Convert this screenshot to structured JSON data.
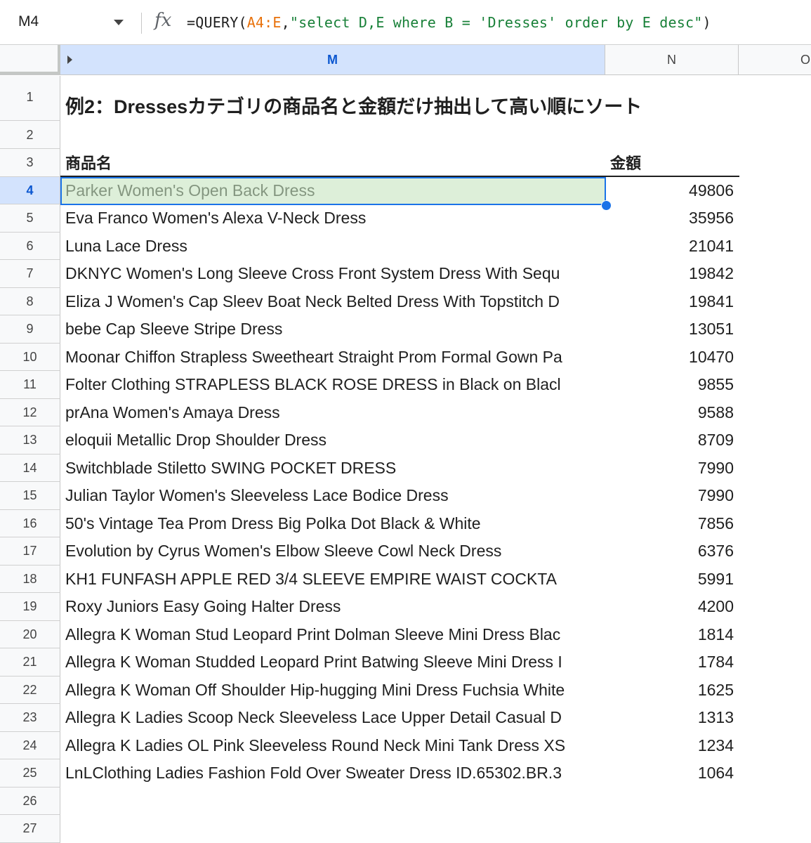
{
  "formula_bar": {
    "cell_ref": "M4",
    "fx_symbol": "fx",
    "formula_prefix": "=QUERY(",
    "formula_range": "A4:E",
    "formula_mid": ",",
    "formula_string": "\"select D,E where B = 'Dresses' order by E desc\"",
    "formula_suffix": ")"
  },
  "columns": {
    "m": "M",
    "n": "N",
    "o": "O"
  },
  "sheet": {
    "title": "例2：Dressesカテゴリの商品名と金額だけ抽出して高い順にソート",
    "header_name": "商品名",
    "header_amount": "金額",
    "rows": [
      {
        "name": "Parker Women's Open Back Dress",
        "amount": "49806"
      },
      {
        "name": "Eva Franco Women's Alexa V-Neck Dress",
        "amount": "35956"
      },
      {
        "name": "Luna Lace Dress",
        "amount": "21041"
      },
      {
        "name": "DKNYC Women's Long Sleeve Cross Front System Dress With Sequ",
        "amount": "19842"
      },
      {
        "name": "Eliza J Women's Cap Sleev Boat Neck Belted Dress With Topstitch D",
        "amount": "19841"
      },
      {
        "name": "bebe Cap Sleeve Stripe Dress",
        "amount": "13051"
      },
      {
        "name": "Moonar Chiffon Strapless Sweetheart Straight Prom Formal Gown Pa",
        "amount": "10470"
      },
      {
        "name": "Folter Clothing STRAPLESS BLACK ROSE DRESS in Black on Blacl",
        "amount": "9855"
      },
      {
        "name": "prAna Women's Amaya Dress",
        "amount": "9588"
      },
      {
        "name": "eloquii Metallic Drop Shoulder Dress",
        "amount": "8709"
      },
      {
        "name": "Switchblade Stiletto SWING POCKET DRESS",
        "amount": "7990"
      },
      {
        "name": "Julian Taylor Women's Sleeveless Lace Bodice Dress",
        "amount": "7990"
      },
      {
        "name": "50's Vintage Tea Prom Dress Big Polka Dot Black & White",
        "amount": "7856"
      },
      {
        "name": "Evolution by Cyrus Women's Elbow Sleeve Cowl Neck Dress",
        "amount": "6376"
      },
      {
        "name": "KH1 FUNFASH APPLE RED 3/4 SLEEVE EMPIRE WAIST COCKTA",
        "amount": "5991"
      },
      {
        "name": "Roxy Juniors Easy Going Halter Dress",
        "amount": "4200"
      },
      {
        "name": "Allegra K Woman Stud Leopard Print Dolman Sleeve Mini Dress Blac",
        "amount": "1814"
      },
      {
        "name": "Allegra K Woman Studded Leopard Print Batwing Sleeve Mini Dress I",
        "amount": "1784"
      },
      {
        "name": "Allegra K Woman Off Shoulder Hip-hugging Mini Dress Fuchsia White",
        "amount": "1625"
      },
      {
        "name": "Allegra K Ladies Scoop Neck Sleeveless Lace Upper Detail Casual D",
        "amount": "1313"
      },
      {
        "name": "Allegra K Ladies OL Pink Sleeveless Round Neck Mini Tank Dress XS",
        "amount": "1234"
      },
      {
        "name": "LnLClothing Ladies Fashion Fold Over Sweater Dress ID.65302.BR.3",
        "amount": "1064"
      }
    ]
  },
  "row_numbers": [
    "1",
    "2",
    "3",
    "4",
    "5",
    "6",
    "7",
    "8",
    "9",
    "10",
    "11",
    "12",
    "13",
    "14",
    "15",
    "16",
    "17",
    "18",
    "19",
    "20",
    "21",
    "22",
    "23",
    "24",
    "25",
    "26",
    "27"
  ],
  "selected_row": "4",
  "colors": {
    "selection_border": "#1a73e8",
    "selection_fill": "#c6e4bf",
    "header_selected": "#d3e3fd"
  }
}
